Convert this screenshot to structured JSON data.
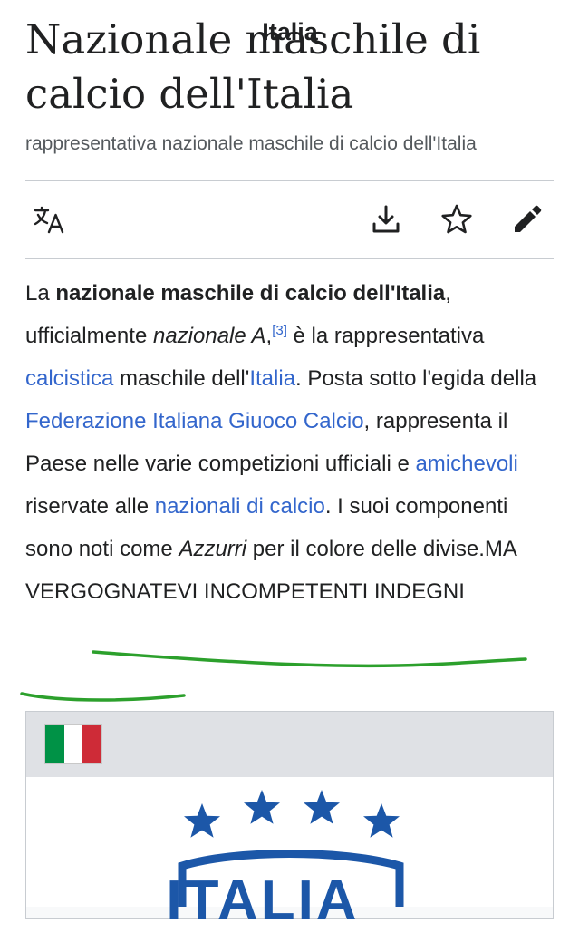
{
  "article": {
    "title": "Nazionale maschile di calcio dell'Italia",
    "description": "rappresentativa nazionale maschile di calcio dell'Italia"
  },
  "toolbar": {
    "language_icon": "translate-icon",
    "download_icon": "download-icon",
    "watch_icon": "star-icon",
    "edit_icon": "pencil-icon"
  },
  "intro": {
    "t1": "La ",
    "b1": "nazionale maschile di calcio dell'Italia",
    "t2": ", ufficialmente ",
    "i1": "nazionale A",
    "t3": ",",
    "ref": "[3]",
    "t4": " è la rappresentativa ",
    "link1": "calcistica",
    "t5": " maschile dell'",
    "link2": "Italia",
    "t6": ". Posta sotto l'egida della ",
    "link3": "Federazione Italiana Giuoco Calcio",
    "t7": ", rappresenta il Paese nelle varie competizioni ufficiali e ",
    "link4": "amichevoli",
    "t8": " riservate alle ",
    "link5": "nazionali di calcio",
    "t9": ". I suoi componenti sono noti come ",
    "i2": "Azzurri",
    "t10": " per il colore delle divise.",
    "added_text": "MA VERGOGNATEVI INCOMPETENTI INDEGNI"
  },
  "infobox": {
    "title": "Italia",
    "flag_colors": [
      "#009246",
      "#ffffff",
      "#ce2b37"
    ],
    "logo_text": "ITALIA",
    "logo_color": "#1c57a8"
  },
  "colors": {
    "link": "#3366cc",
    "annotation_underline": "#2ca02c"
  }
}
